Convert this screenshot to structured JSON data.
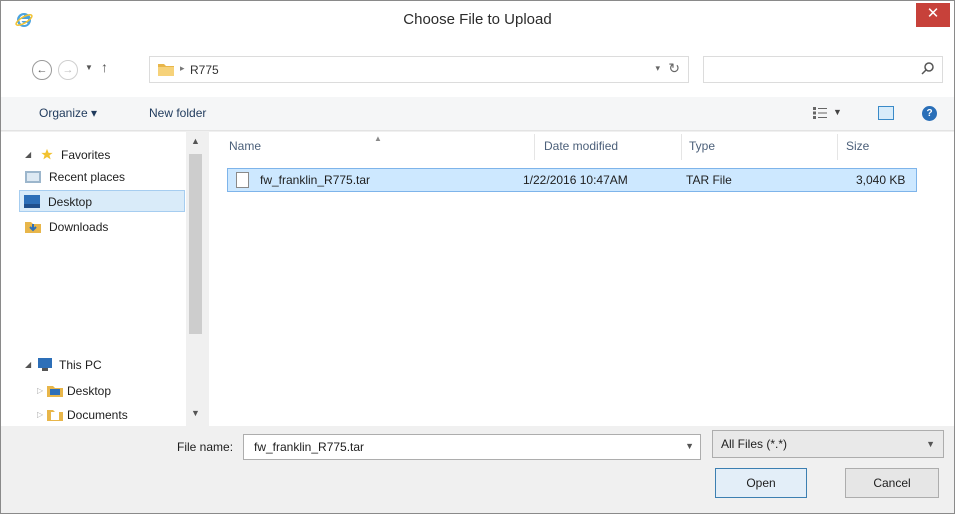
{
  "window": {
    "title": "Choose File to Upload",
    "close_glyph": "✕"
  },
  "address": {
    "path": "R775",
    "separator": "▸",
    "search_placeholder": ""
  },
  "toolbar": {
    "organize_label": "Organize ▾",
    "new_folder_label": "New folder",
    "help_glyph": "?"
  },
  "nav": {
    "items": [
      {
        "label": "Favorites",
        "icon": "star-icon"
      },
      {
        "label": "Recent places",
        "icon": "recent-places-icon"
      },
      {
        "label": "Desktop",
        "icon": "desktop-icon",
        "selected": true
      },
      {
        "label": "Downloads",
        "icon": "downloads-icon"
      },
      {
        "label": "This PC",
        "icon": "computer-icon"
      },
      {
        "label": "Desktop",
        "icon": "desktop-folder-icon"
      },
      {
        "label": "Documents",
        "icon": "documents-icon"
      }
    ]
  },
  "filelist": {
    "columns": [
      "Name",
      "Date modified",
      "Type",
      "Size"
    ],
    "rows": [
      {
        "name": "fw_franklin_R775.tar",
        "date": "1/22/2016 10:47AM",
        "type": "TAR File",
        "size": "3,040 KB"
      }
    ]
  },
  "bottom": {
    "file_name_label": "File name:",
    "file_name_value": "fw_franklin_R775.tar",
    "file_type_value": "All Files (*.*)",
    "open_label": "Open",
    "cancel_label": "Cancel"
  },
  "colors": {
    "selection": "#cde8ff",
    "close": "#c7413a",
    "accent": "#2a6fb8"
  }
}
